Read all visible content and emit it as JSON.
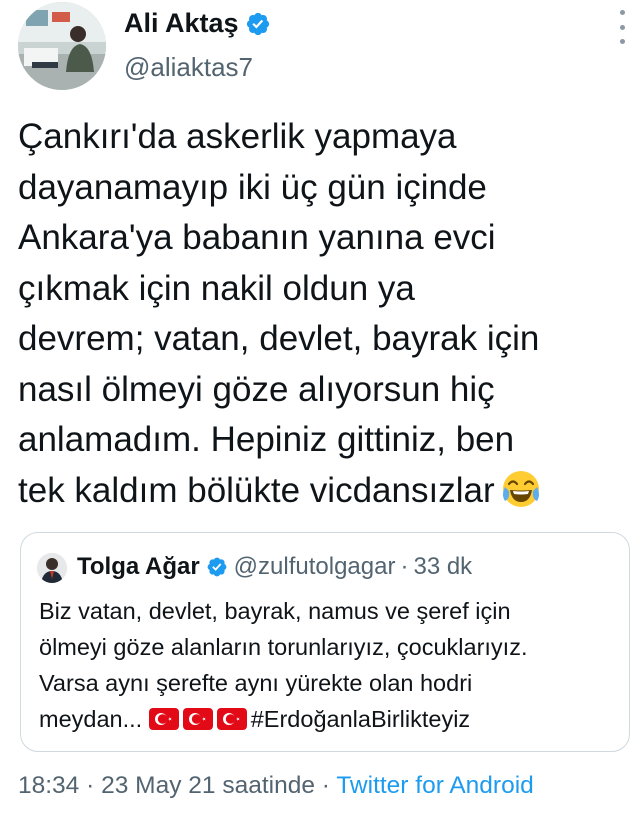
{
  "author": {
    "display_name": "Ali Aktaş",
    "handle": "@aliaktas7",
    "verified": true
  },
  "tweet": {
    "lines": [
      "Çankırı'da askerlik yapmaya",
      "dayanamayıp iki üç gün içinde",
      "Ankara'ya babanın yanına evci",
      "çıkmak için nakil oldun ya",
      "devrem; vatan, devlet, bayrak için",
      "nasıl ölmeyi göze alıyorsun hiç",
      "anlamadım. Hepiniz gittiniz, ben",
      "tek kaldım bölükte vicdansızlar"
    ],
    "emoji": "face-with-tears-of-joy"
  },
  "quoted": {
    "display_name": "Tolga Ağar",
    "handle": "@zulfutolgagar",
    "separator": "·",
    "time": "33 dk",
    "lines": [
      "Biz vatan, devlet, bayrak, namus ve şeref için",
      "ölmeyi göze alanların torunlarıyız, çocuklarıyız.",
      "Varsa aynı şerefte aynı yürekte olan hodri"
    ],
    "last_line_prefix": "meydan...",
    "flags": [
      "turkey-flag",
      "turkey-flag",
      "turkey-flag"
    ],
    "hashtag": "#ErdoğanlaBirlikteyiz"
  },
  "footer": {
    "time": "18:34",
    "sep1": "·",
    "date": "23 May 21 saatinde",
    "sep2": "·",
    "source": "Twitter for Android"
  },
  "colors": {
    "text": "#0f1419",
    "secondary": "#536471",
    "link": "#1d9bf0",
    "verified": "#1d9bf0",
    "border": "#cfd9de",
    "flag_red": "#e30a17"
  }
}
